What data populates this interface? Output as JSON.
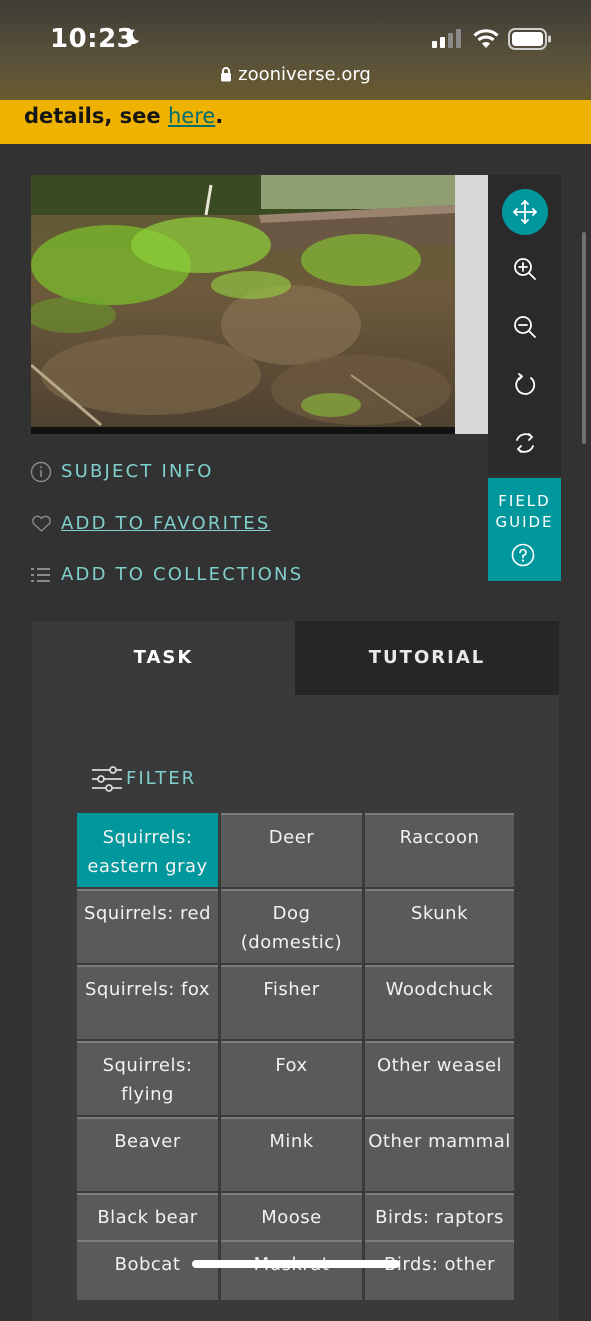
{
  "status_bar": {
    "time": "10:23"
  },
  "browser": {
    "url": "zooniverse.org"
  },
  "banner": {
    "text_before": "details, see ",
    "link": "here",
    "text_after": "."
  },
  "image_toolbar": {
    "buttons": [
      "move-icon",
      "zoom-in-icon",
      "zoom-out-icon",
      "rotate-icon",
      "reset-icon"
    ],
    "field_guide": {
      "line1": "FIELD",
      "line2": "GUIDE"
    }
  },
  "subject": {
    "info_label": "SUBJECT INFO",
    "favorites_label": "ADD TO FAVORITES",
    "collections_label": "ADD TO COLLECTIONS"
  },
  "tabs": {
    "task": "TASK",
    "tutorial": "TUTORIAL"
  },
  "filter": {
    "label": "FILTER"
  },
  "choices": [
    [
      "Squirrels: eastern gray",
      "Deer",
      "Raccoon"
    ],
    [
      "Squirrels: red",
      "Dog (domestic)",
      "Skunk"
    ],
    [
      "Squirrels: fox",
      "Fisher",
      "Woodchuck"
    ],
    [
      "Squirrels: flying",
      "Fox",
      "Other weasel"
    ],
    [
      "Beaver",
      "Mink",
      "Other mammal"
    ],
    [
      "Black bear",
      "Moose",
      "Birds: raptors"
    ],
    [
      "Bobcat",
      "Muskrat",
      "Birds: other"
    ]
  ],
  "selected_choice": "Squirrels: eastern gray",
  "colors": {
    "accent": "#00979d",
    "banner": "#f0b200",
    "link": "#7fd0ce"
  }
}
